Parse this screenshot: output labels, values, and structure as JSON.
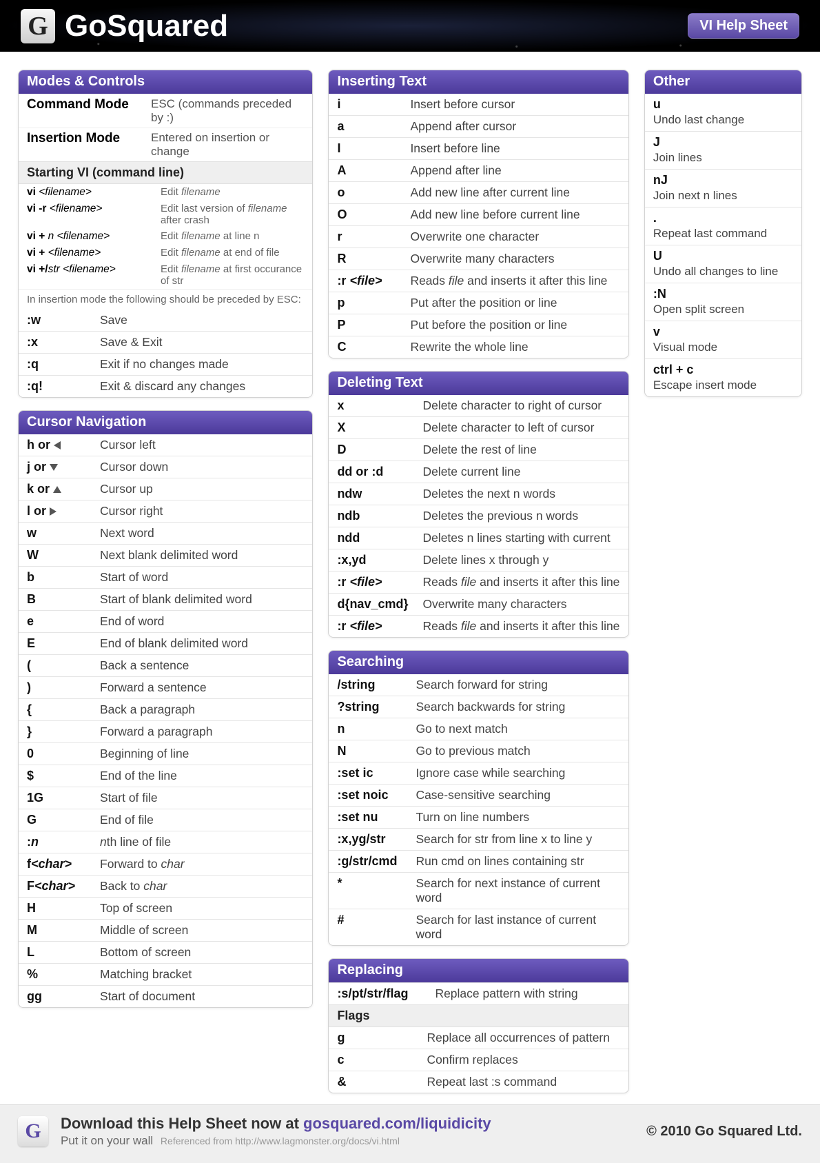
{
  "header": {
    "brand": "GoSquared",
    "badge": "VI Help Sheet"
  },
  "footer": {
    "line1_pre": "Download this Help Sheet now at ",
    "line1_link": "gosquared.com/liquidicity",
    "line2_a": "Put it on your wall",
    "line2_ref": "Referenced from http://www.lagmonster.org/docs/vi.html",
    "copyright": "© 2010 Go Squared Ltd."
  },
  "cards": {
    "modes": {
      "title": "Modes & Controls",
      "pairs": [
        {
          "l": "Command Mode",
          "r": "ESC (commands preceded by :)"
        },
        {
          "l": "Insertion Mode",
          "r": "Entered on insertion or change"
        }
      ],
      "sub": "Starting VI (command line)",
      "cli": [
        {
          "cmd": "vi <filename>",
          "desc": "Edit filename",
          "cmd_em": "<filename>",
          "desc_em": "filename"
        },
        {
          "cmd": "vi -r <filename>",
          "desc": "Edit last version of filename after crash",
          "cmd_em": "<filename>",
          "desc_em": "filename"
        },
        {
          "cmd": "vi + n <filename>",
          "desc": "Edit filename at line n",
          "cmd_em": "n <filename>",
          "desc_em": "filename"
        },
        {
          "cmd": "vi + <filename>",
          "desc": "Edit filename at end of file",
          "cmd_em": "<filename>",
          "desc_em": "filename"
        },
        {
          "cmd": "vi +/str <filename>",
          "desc": "Edit filename at first occurance of str",
          "cmd_em": "str <filename>",
          "desc_em": "filename"
        }
      ],
      "note": "In insertion mode the following should be preceded by ESC:",
      "rows": [
        {
          "k": ":w",
          "d": "Save"
        },
        {
          "k": ":x",
          "d": "Save & Exit"
        },
        {
          "k": ":q",
          "d": "Exit if no changes made"
        },
        {
          "k": ":q!",
          "d": "Exit & discard any changes"
        }
      ]
    },
    "cursor": {
      "title": "Cursor Navigation",
      "rows": [
        {
          "k": "h or",
          "arrow": "l",
          "d": "Cursor left"
        },
        {
          "k": "j or",
          "arrow": "dn",
          "d": "Cursor down"
        },
        {
          "k": "k or",
          "arrow": "u",
          "d": "Cursor up"
        },
        {
          "k": "l or",
          "arrow": "r",
          "d": "Cursor right"
        },
        {
          "k": "w",
          "d": "Next word"
        },
        {
          "k": "W",
          "d": "Next blank delimited word"
        },
        {
          "k": "b",
          "d": "Start of word"
        },
        {
          "k": "B",
          "d": "Start of blank delimited word"
        },
        {
          "k": "e",
          "d": "End of word"
        },
        {
          "k": "E",
          "d": "End of blank delimited word"
        },
        {
          "k": "(",
          "d": "Back a sentence"
        },
        {
          "k": ")",
          "d": "Forward a sentence"
        },
        {
          "k": "{",
          "d": "Back a paragraph"
        },
        {
          "k": "}",
          "d": "Forward a paragraph"
        },
        {
          "k": "0",
          "d": "Beginning of line"
        },
        {
          "k": "$",
          "d": "End of the line"
        },
        {
          "k": "1G",
          "d": "Start of file"
        },
        {
          "k": "G",
          "d": "End of file"
        },
        {
          "k": ":n",
          "d": "nth line of file",
          "k_em": "n",
          "d_em": "n"
        },
        {
          "k": "f<char>",
          "d": "Forward to char",
          "k_em": "<char>",
          "d_em": "char"
        },
        {
          "k": "F<char>",
          "d": "Back to char",
          "k_em": "<char>",
          "d_em": "char"
        },
        {
          "k": "H",
          "d": "Top of screen"
        },
        {
          "k": "M",
          "d": "Middle of screen"
        },
        {
          "k": "L",
          "d": "Bottom of screen"
        },
        {
          "k": "%",
          "d": "Matching bracket"
        },
        {
          "k": "gg",
          "d": "Start of document"
        }
      ]
    },
    "insert": {
      "title": "Inserting Text",
      "rows": [
        {
          "k": "i",
          "d": "Insert before cursor"
        },
        {
          "k": "a",
          "d": "Append after cursor"
        },
        {
          "k": "I",
          "d": "Insert before line"
        },
        {
          "k": "A",
          "d": "Append after line"
        },
        {
          "k": "o",
          "d": "Add new line after current line"
        },
        {
          "k": "O",
          "d": "Add new line before current line"
        },
        {
          "k": "r",
          "d": "Overwrite one character"
        },
        {
          "k": "R",
          "d": "Overwrite many characters"
        },
        {
          "k": ":r <file>",
          "d": "Reads file and inserts it after this line",
          "k_em": "<file>",
          "d_em": "file"
        },
        {
          "k": "p",
          "d": "Put after the position or line"
        },
        {
          "k": "P",
          "d": "Put before the position or line"
        },
        {
          "k": "C",
          "d": "Rewrite the whole line"
        }
      ]
    },
    "delete": {
      "title": "Deleting Text",
      "rows": [
        {
          "k": "x",
          "d": "Delete character to right of cursor"
        },
        {
          "k": "X",
          "d": "Delete character to left of cursor"
        },
        {
          "k": "D",
          "d": "Delete the rest of line"
        },
        {
          "k": "dd or :d",
          "d": "Delete current line"
        },
        {
          "k": "ndw",
          "d": "Deletes the next n words"
        },
        {
          "k": "ndb",
          "d": "Deletes the previous n words"
        },
        {
          "k": "ndd",
          "d": "Deletes n lines starting with current"
        },
        {
          "k": ":x,yd",
          "d": "Delete lines x through y"
        },
        {
          "k": ":r <file>",
          "d": "Reads file and inserts it after this line",
          "k_em": "<file>",
          "d_em": "file"
        },
        {
          "k": "d{nav_cmd}",
          "d": "Overwrite many characters"
        },
        {
          "k": ":r <file>",
          "d": "Reads file and inserts it after this line",
          "k_em": "<file>",
          "d_em": "file"
        }
      ]
    },
    "search": {
      "title": "Searching",
      "rows": [
        {
          "k": "/string",
          "d": "Search forward for string"
        },
        {
          "k": "?string",
          "d": "Search backwards for string"
        },
        {
          "k": "n",
          "d": "Go to next match"
        },
        {
          "k": "N",
          "d": "Go to previous match"
        },
        {
          "k": ":set ic",
          "d": "Ignore case while searching"
        },
        {
          "k": ":set noic",
          "d": "Case-sensitive searching"
        },
        {
          "k": ":set nu",
          "d": "Turn on line numbers"
        },
        {
          "k": ":x,yg/str",
          "d": "Search for str from line x to line y"
        },
        {
          "k": ":g/str/cmd",
          "d": "Run cmd on lines containing str"
        },
        {
          "k": "*",
          "d": "Search for next instance of current word"
        },
        {
          "k": "#",
          "d": "Search for last instance of current word"
        }
      ]
    },
    "replace": {
      "title": "Replacing",
      "top": {
        "k": ":s/pt/str/flag",
        "d": "Replace pattern with string"
      },
      "sub": "Flags",
      "rows": [
        {
          "k": "g",
          "d": "Replace all occurrences of pattern"
        },
        {
          "k": "c",
          "d": "Confirm replaces"
        },
        {
          "k": "&",
          "d": "Repeat last :s command"
        }
      ]
    },
    "other": {
      "title": "Other",
      "rows": [
        {
          "k": "u",
          "d": "Undo last change"
        },
        {
          "k": "J",
          "d": "Join lines"
        },
        {
          "k": "nJ",
          "d": "Join next n lines"
        },
        {
          "k": ".",
          "d": "Repeat last command"
        },
        {
          "k": "U",
          "d": "Undo all changes to line"
        },
        {
          "k": ":N",
          "d": "Open split screen"
        },
        {
          "k": "v",
          "d": "Visual mode"
        },
        {
          "k": "ctrl + c",
          "d": "Escape insert mode"
        }
      ]
    }
  }
}
